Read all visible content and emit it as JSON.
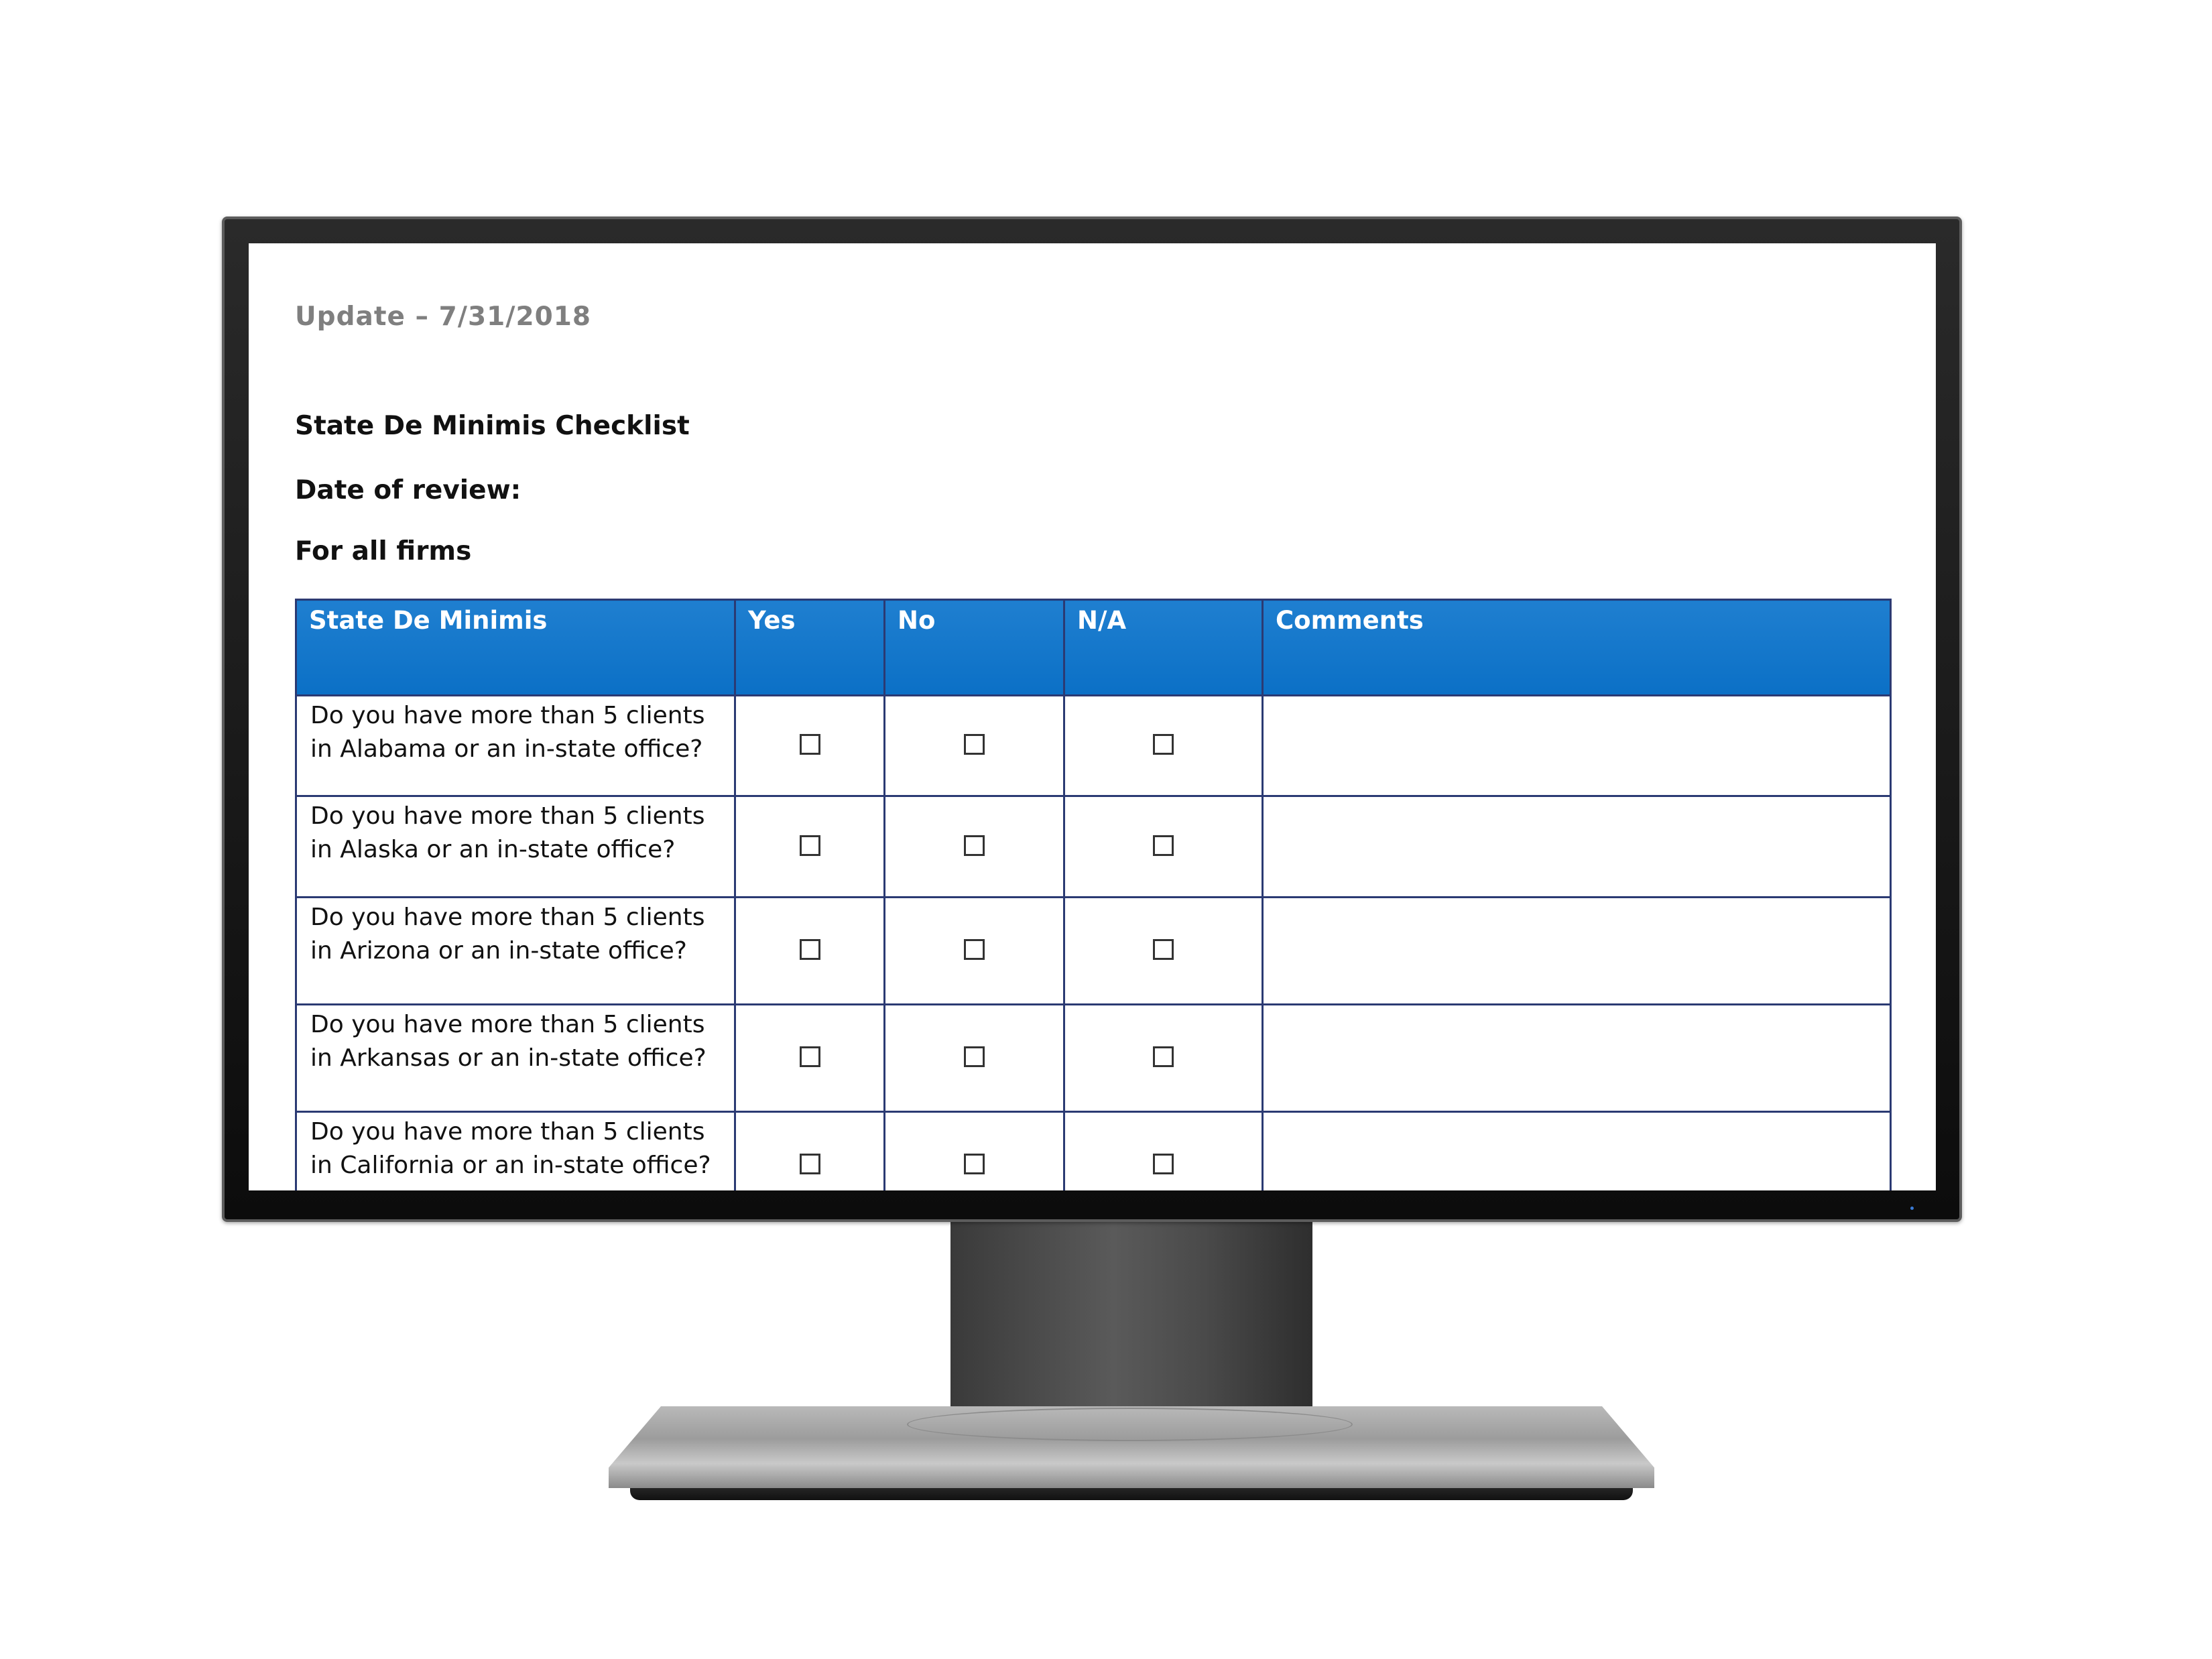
{
  "document": {
    "update_line": "Update – 7/31/2018",
    "title": "State De Minimis Checklist",
    "review_label": "Date of review:",
    "scope_label": "For all firms"
  },
  "table": {
    "header_color": "#0b70c6",
    "border_color": "#2b3a73",
    "columns": [
      "State De Minimis",
      "Yes",
      "No",
      "N/A",
      "Comments"
    ],
    "rows": [
      {
        "question": "Do you have more than 5 clients in Alabama or an in-state office?",
        "yes": false,
        "no": false,
        "na": false,
        "comments": ""
      },
      {
        "question": "Do you have more than 5 clients in Alaska or an in-state office?",
        "yes": false,
        "no": false,
        "na": false,
        "comments": ""
      },
      {
        "question": "Do you have more than 5 clients in Arizona or an in-state office?",
        "yes": false,
        "no": false,
        "na": false,
        "comments": ""
      },
      {
        "question": "Do you have more than 5 clients in Arkansas or an in-state office?",
        "yes": false,
        "no": false,
        "na": false,
        "comments": ""
      },
      {
        "question": "Do you have more than 5 clients in California or an in-state office?",
        "yes": false,
        "no": false,
        "na": false,
        "comments": ""
      }
    ]
  }
}
